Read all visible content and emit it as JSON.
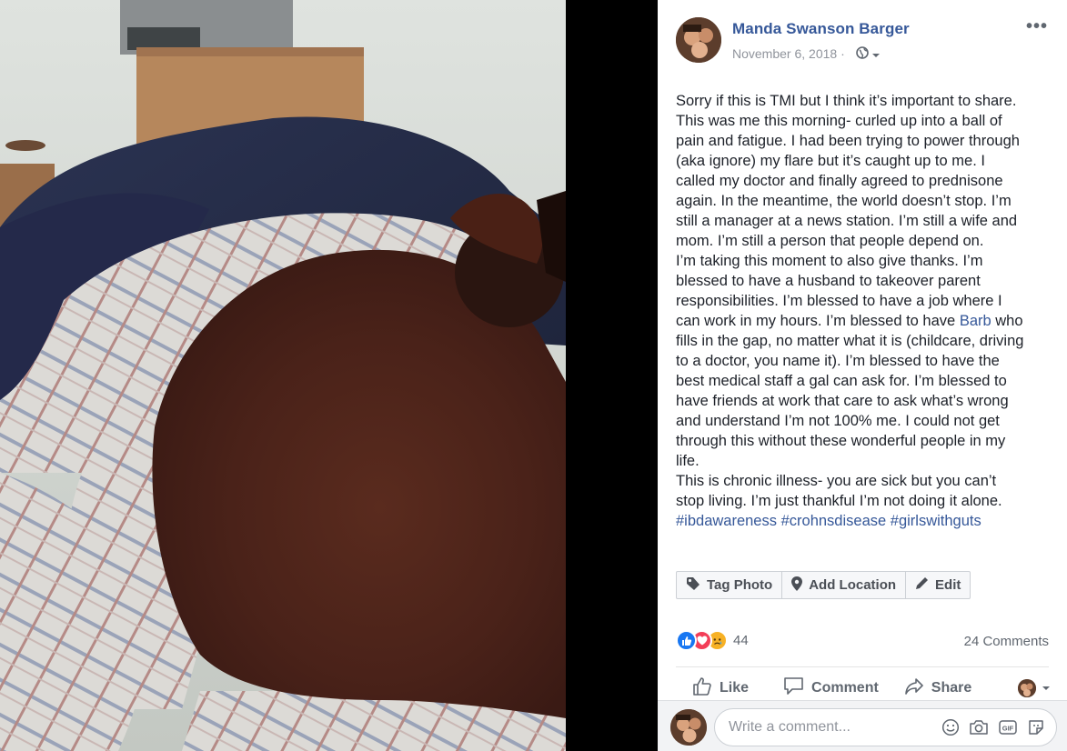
{
  "post": {
    "author": "Manda Swanson Barger",
    "date": "November 6, 2018",
    "date_separator": "·",
    "more_label": "•••",
    "privacy_icon": "globe-icon",
    "body_lines": [
      "Sorry if this is TMI but I think it’s important to share.",
      "This was me this morning- curled up into a ball of",
      "pain and fatigue. I had been trying to power through",
      "(aka ignore) my flare but it’s caught up to me. I",
      "called my doctor and finally agreed to prednisone",
      "again. In the meantime, the world doesn’t stop. I’m",
      "still a manager at a news station. I’m still a wife and",
      "mom. I’m still a person that people depend on.",
      "I’m taking this moment to also give thanks. I’m",
      "blessed to have a husband to takeover parent",
      "responsibilities. I’m blessed to have a job where I",
      "can work in my hours. I’m blessed to have ",
      "fills in the gap, no matter what it is (childcare, driving",
      "to a doctor, you name it). I’m blessed to have the",
      "best medical staff a gal can ask for. I’m blessed to",
      "have friends at work that care to ask what’s wrong",
      "and understand I’m not 100% me. I could not get",
      "through this without these wonderful people in my",
      "life.",
      "This is chronic illness- you are sick but you can’t",
      "stop living. I’m just thankful I’m not doing it alone."
    ],
    "mention": "Barb",
    "mention_suffix": " who",
    "hashtags": [
      "#ibdawareness",
      "#crohnsdisease",
      "#girlswithguts"
    ]
  },
  "photo_actions": {
    "tag_photo": "Tag Photo",
    "add_location": "Add Location",
    "edit": "Edit"
  },
  "engagement": {
    "reaction_types": [
      "like",
      "love",
      "sad"
    ],
    "reaction_count": "44",
    "comments": "24 Comments"
  },
  "actions": {
    "like": "Like",
    "comment": "Comment",
    "share": "Share"
  },
  "composer": {
    "placeholder": "Write a comment...",
    "icons": [
      "emoji-icon",
      "camera-icon",
      "gif-icon",
      "sticker-icon"
    ]
  },
  "colors": {
    "link": "#365899",
    "like_reaction": "#1877f2",
    "love_reaction": "#f33e58",
    "sad_reaction": "#f7b125"
  }
}
